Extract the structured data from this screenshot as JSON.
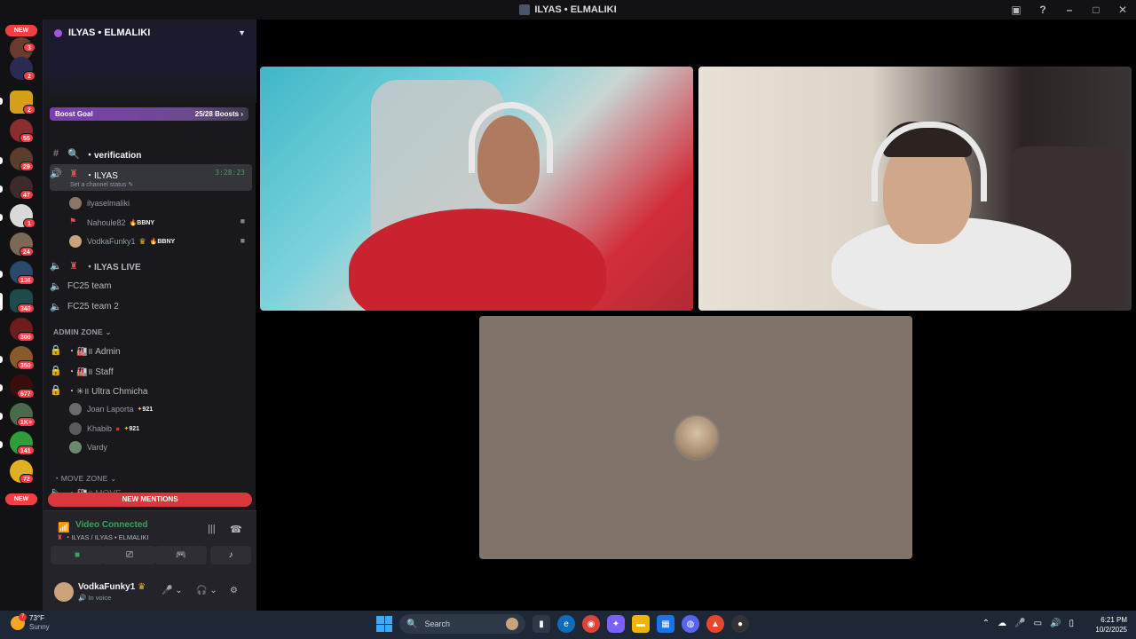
{
  "window": {
    "title": "ILYAS • ELMALIKI"
  },
  "guilds": {
    "new_top": "NEW",
    "new_bottom": "NEW",
    "badges": [
      "3",
      "2",
      "2",
      "55",
      "29",
      "47",
      "1",
      "24",
      "136",
      "340",
      "300",
      "350",
      "677",
      "1K+",
      "141",
      "72"
    ]
  },
  "server": {
    "name": "ILYAS • ELMALIKI",
    "boost_label": "Boost Goal",
    "boost_value": "25/28 Boosts"
  },
  "channels": {
    "verification": "・verification",
    "voice_active": "・ILYAS",
    "voice_active_time": "3:28:23",
    "voice_status_placeholder": "Set a channel status",
    "voice_users": [
      {
        "name": "ilyaselmaliki",
        "tag": ""
      },
      {
        "name": "Nahoule82",
        "tag": "BBNY"
      },
      {
        "name": "VodkaFunky1",
        "tag": "BBNY"
      }
    ],
    "ilyas_live": "・ILYAS LIVE",
    "fc25_team": "FC25 team",
    "fc25_team2": "FC25 team 2",
    "admin_zone": "ADMIN ZONE",
    "admin": "・🏭॥ Admin",
    "staff": "・🏭॥ Staff",
    "ultra": "・✳॥ Ultra Chmicha",
    "admin_users": [
      {
        "name": "Joan Laporta",
        "tag": "921"
      },
      {
        "name": "Khabib",
        "tag": "921"
      },
      {
        "name": "Vardy",
        "tag": ""
      }
    ],
    "move_zone": "・MOVE ZONE",
    "move_partial": "・🏭॥ MOVE"
  },
  "new_mentions": "NEW MENTIONS",
  "voice": {
    "status": "Video Connected",
    "channel": "・ILYAS / ILYAS • ELMALIKI"
  },
  "me": {
    "name": "VodkaFunky1",
    "status": "In voice"
  },
  "taskbar": {
    "temp": "73°F",
    "weather": "Sunny",
    "weather_badge": "7",
    "search_placeholder": "Search",
    "time": "6:21 PM",
    "date": "10/2/2025"
  }
}
